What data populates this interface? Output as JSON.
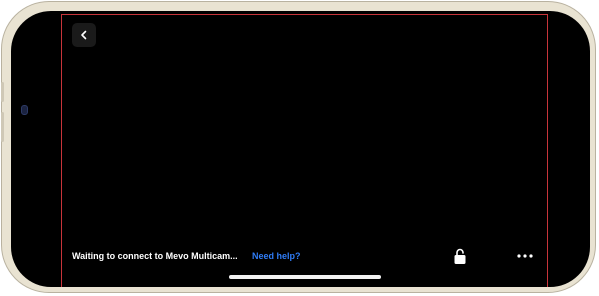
{
  "status": {
    "message": "Waiting to connect to Mevo Multicam...",
    "help_link": "Need help?"
  },
  "icons": {
    "back": "chevron-left-icon",
    "unlock": "unlock-icon",
    "more": "ellipsis-icon"
  },
  "colors": {
    "frame_outline": "#c8343a",
    "link": "#2f7cf6",
    "background": "#000000",
    "device_bezel": "#e9e3d2"
  }
}
